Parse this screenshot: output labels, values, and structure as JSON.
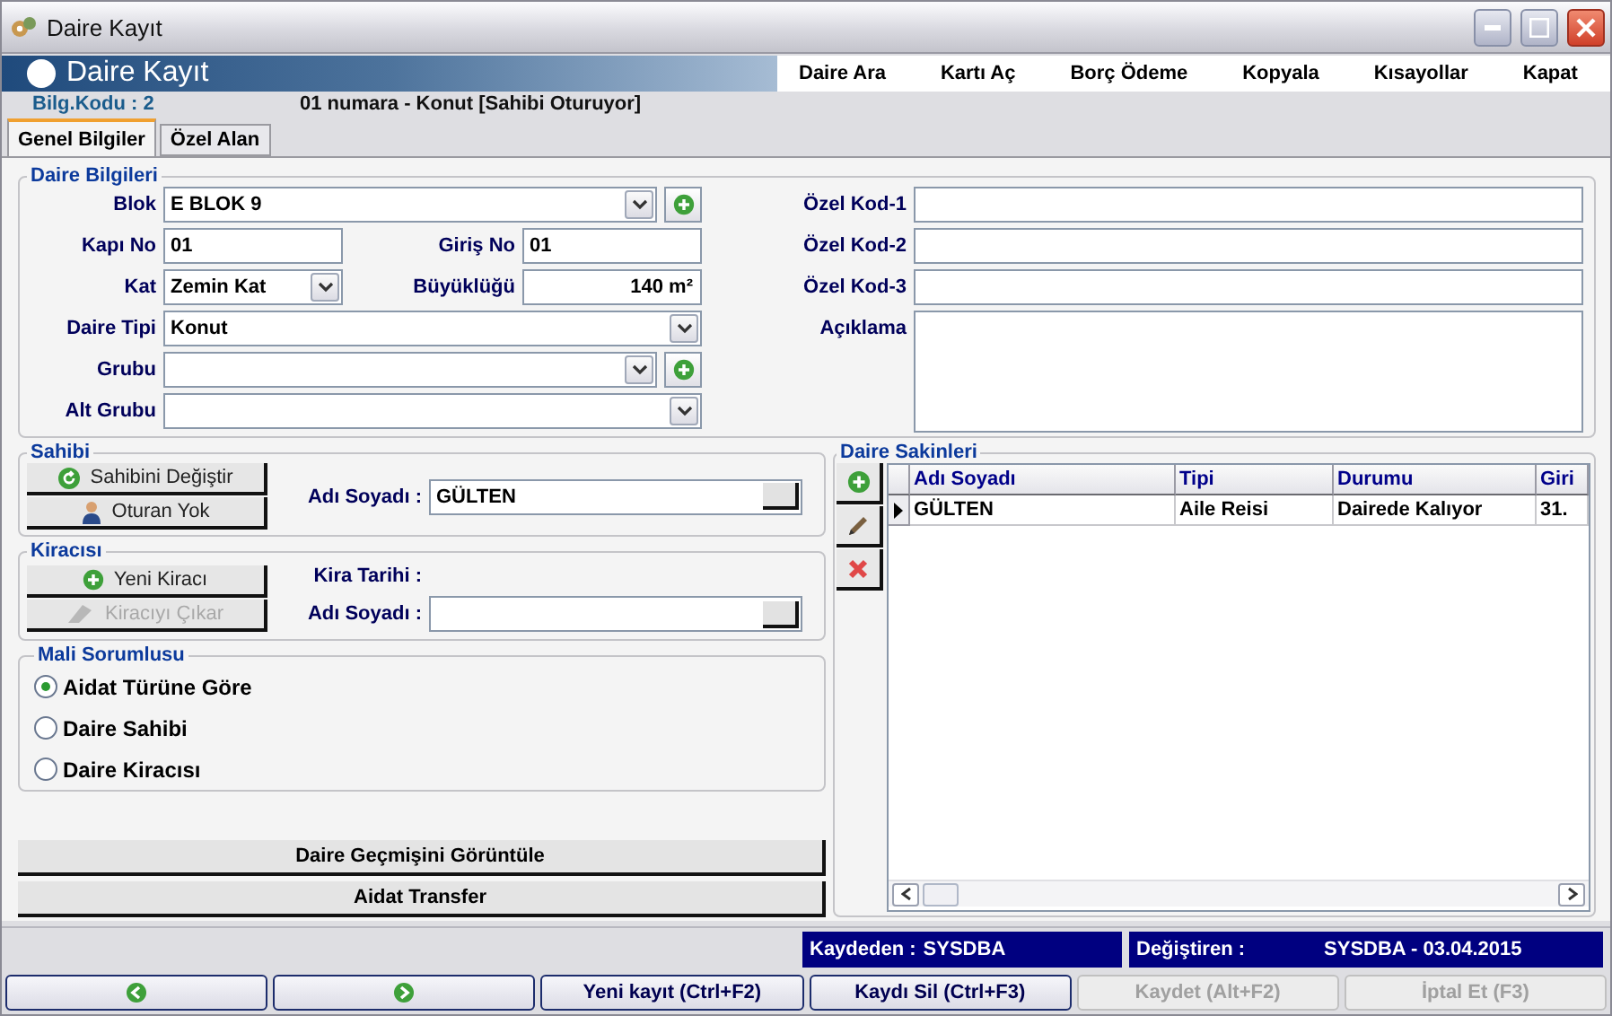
{
  "window": {
    "title": "Daire Kayıt"
  },
  "header": {
    "title": "Daire Kayıt"
  },
  "menu": [
    "Daire Ara",
    "Kartı Aç",
    "Borç Ödeme",
    "Kopyala",
    "Kısayollar",
    "Kapat"
  ],
  "info": {
    "code": "Bilg.Kodu : 2",
    "description": "01 numara - Konut [Sahibi Oturuyor]"
  },
  "tabs": [
    {
      "label": "Genel Bilgiler",
      "selected": true
    },
    {
      "label": "Özel Alan",
      "selected": false
    }
  ],
  "daire_bilgileri": {
    "title": "Daire Bilgileri",
    "rows": [
      {
        "label": "Blok",
        "kind": "combo",
        "value": "E BLOK 9",
        "add_button": true
      },
      {
        "label": "Kapı No",
        "kind": "text",
        "value": "01",
        "second": {
          "label": "Giriş No",
          "kind": "text",
          "value": "01"
        }
      },
      {
        "label": "Kat",
        "kind": "combo",
        "value": "Zemin Kat",
        "second": {
          "label": "Büyüklüğü",
          "kind": "number",
          "value": "140 m²"
        }
      },
      {
        "label": "Daire Tipi",
        "kind": "combo",
        "value": "Konut"
      },
      {
        "label": "Grubu",
        "kind": "combo",
        "add_button": true
      },
      {
        "label": "Alt Grubu",
        "kind": "combo"
      }
    ],
    "extra": [
      {
        "label": "Özel Kod-1",
        "kind": "text"
      },
      {
        "label": "Özel Kod-2",
        "kind": "text"
      },
      {
        "label": "Özel Kod-3",
        "kind": "text"
      },
      {
        "label": "Açıklama",
        "kind": "memo"
      }
    ]
  },
  "sahibi": {
    "title": "Sahibi",
    "buttons": [
      {
        "label": "Sahibini Değiştir",
        "kind": "change",
        "disabled": false
      },
      {
        "label": "Oturan Yok",
        "kind": "person",
        "disabled": false
      }
    ],
    "name_label": "Adı Soyadı :",
    "name": "GÜLTEN"
  },
  "kiracisi": {
    "title": "Kiracısı",
    "buttons": [
      {
        "label": "Yeni Kiracı",
        "kind": "add",
        "disabled": false
      },
      {
        "label": "Kiracıyı Çıkar",
        "kind": "remove",
        "disabled": true
      }
    ],
    "date_label": "Kira Tarihi :",
    "name_label": "Adı Soyadı :"
  },
  "mali_sorumlusu": {
    "title": "Mali Sorumlusu",
    "options": [
      {
        "label": "Aidat Türüne Göre",
        "selected": true
      },
      {
        "label": "Daire Sahibi",
        "selected": false
      },
      {
        "label": "Daire Kiracısı",
        "selected": false
      }
    ]
  },
  "actions": [
    "Daire Geçmişini Görüntüle",
    "Aidat Transfer"
  ],
  "sakinleri": {
    "title": "Daire Sakinleri",
    "tools": [
      {
        "kind": "add"
      },
      {
        "kind": "edit"
      },
      {
        "kind": "delete"
      }
    ],
    "columns": [
      "Adı Soyadı",
      "Tipi",
      "Durumu",
      "Giri"
    ],
    "rows": [
      {
        "cells": [
          "GÜLTEN",
          "Aile Reisi",
          "Dairede Kalıyor",
          "31."
        ],
        "selected": true
      }
    ]
  },
  "status_bar": [
    {
      "label": "Kaydeden :",
      "value": "SYSDBA"
    },
    {
      "label": "Değiştiren :",
      "value": "SYSDBA - 03.04.2015"
    }
  ],
  "buttons": [
    {
      "kind": "prev",
      "disabled": false
    },
    {
      "kind": "next",
      "disabled": false
    },
    {
      "kind": "text",
      "label": "Yeni kayıt (Ctrl+F2)",
      "disabled": false
    },
    {
      "kind": "text",
      "label": "Kaydı Sil (Ctrl+F3)",
      "disabled": false
    },
    {
      "kind": "text",
      "label": "Kaydet (Alt+F2)",
      "disabled": true
    },
    {
      "kind": "text",
      "label": "İptal Et (F3)",
      "disabled": true
    }
  ]
}
